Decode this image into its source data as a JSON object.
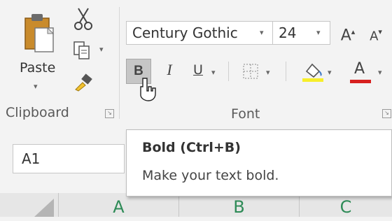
{
  "clipboard": {
    "paste_label": "Paste",
    "group_label": "Clipboard",
    "icons": [
      "paste-icon",
      "cut-icon",
      "copy-icon",
      "format-painter-icon"
    ]
  },
  "font": {
    "font_name": "Century Gothic",
    "font_size": "24",
    "grow_label": "A",
    "shrink_label": "A",
    "bold_label": "B",
    "italic_label": "I",
    "underline_label": "U",
    "font_color_label": "A",
    "group_label": "Font",
    "highlight_color": "#f7ee2a",
    "font_color": "#d7201f"
  },
  "namebox": {
    "value": "A1"
  },
  "columns": [
    "A",
    "B",
    "C"
  ],
  "tooltip": {
    "title": "Bold (Ctrl+B)",
    "description": "Make your text bold."
  }
}
